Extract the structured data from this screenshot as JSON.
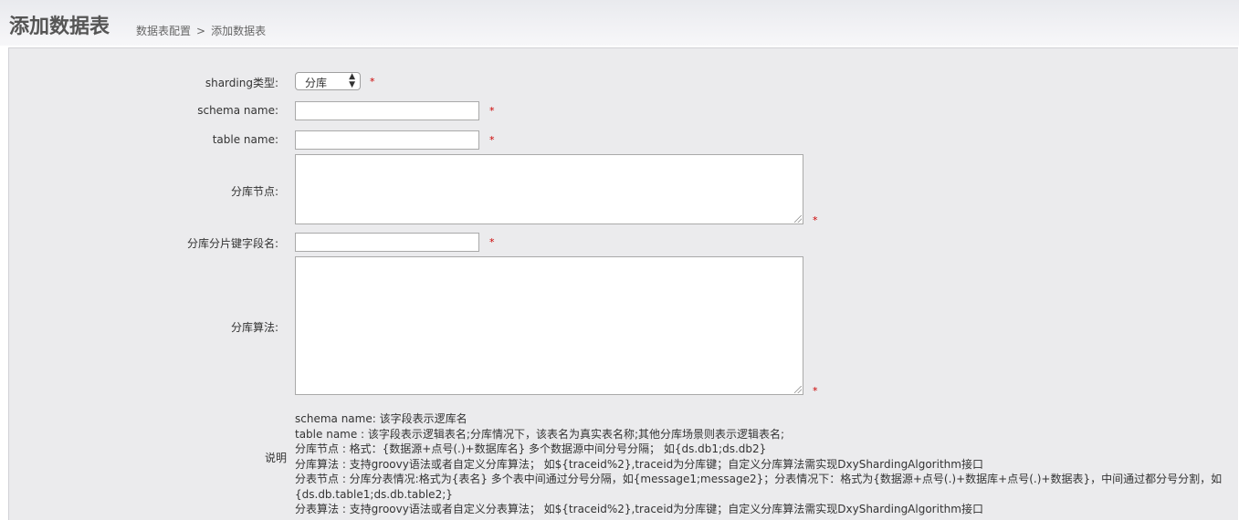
{
  "page": {
    "title": "添加数据表",
    "breadcrumb": [
      "数据表配置",
      ">",
      "添加数据表"
    ]
  },
  "form": {
    "sharding_type": {
      "label": "sharding类型:",
      "value": "分库",
      "required": "*"
    },
    "schema_name": {
      "label": "schema name:",
      "value": "",
      "required": "*"
    },
    "table_name": {
      "label": "table name:",
      "value": "",
      "required": "*"
    },
    "db_nodes": {
      "label": "分库节点:",
      "value": "",
      "required": "*"
    },
    "db_shard_key": {
      "label": "分库分片键字段名:",
      "value": "",
      "required": "*"
    },
    "db_algorithm": {
      "label": "分库算法:",
      "value": "",
      "required": "*"
    }
  },
  "description": {
    "label": "说明",
    "lines": [
      "schema name: 该字段表示逻库名",
      "table name : 该字段表示逻辑表名;分库情况下，该表名为真实表名称;其他分库场景则表示逻辑表名;",
      "分库节点 : 格式：{数据源+点号(.)+数据库名} 多个数据源中间分号分隔； 如{ds.db1;ds.db2}",
      "分库算法 : 支持groovy语法或者自定义分库算法； 如${traceid%2},traceid为分库键；自定义分库算法需实现DxyShardingAlgorithm接口",
      "分表节点 : 分库分表情况:格式为{表名} 多个表中间通过分号分隔，如{message1;message2}；分表情况下：格式为{数据源+点号(.)+数据库+点号(.)+数据表}，中间通过都分号分割，如{ds.db.table1;ds.db.table2;}",
      "分表算法 : 支持groovy语法或者自定义分表算法； 如${traceid%2},traceid为分库键；自定义分库算法需实现DxyShardingAlgorithm接口"
    ]
  }
}
